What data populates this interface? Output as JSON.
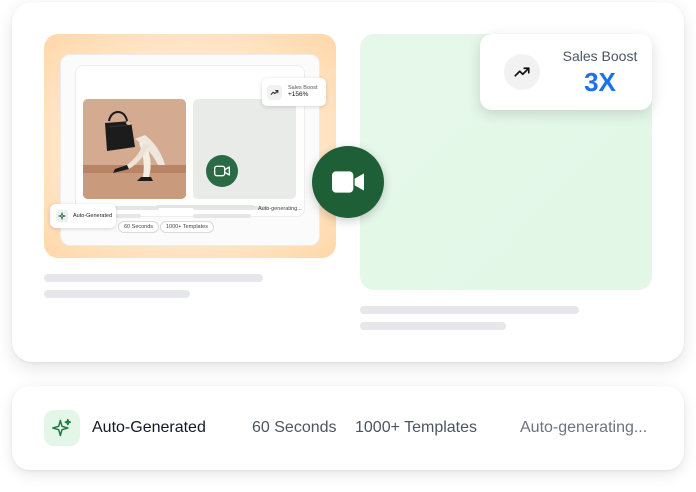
{
  "preview": {
    "sales_badge": {
      "icon": "trend-up-icon",
      "label": "Sales Boost",
      "value": "+156%"
    },
    "auto_badge": {
      "icon": "sparkles-icon",
      "label": "Auto-Generated"
    },
    "chips": [
      "60 Seconds",
      "1000+ Templates"
    ],
    "status": "Auto-generating..."
  },
  "sales_card": {
    "icon": "trend-up-icon",
    "label": "Sales Boost",
    "value": "3X"
  },
  "camera": {
    "icon": "video-camera-icon"
  },
  "bottom_bar": {
    "icon": "sparkles-icon",
    "auto_label": "Auto-Generated",
    "duration": "60 Seconds",
    "templates": "1000+ Templates",
    "status": "Auto-generating..."
  },
  "colors": {
    "brand_green": "#1e5f38",
    "accent_blue": "#1a73e8",
    "green_panel": "#e4f8e8",
    "preview_orange": "#ffdcb3"
  }
}
